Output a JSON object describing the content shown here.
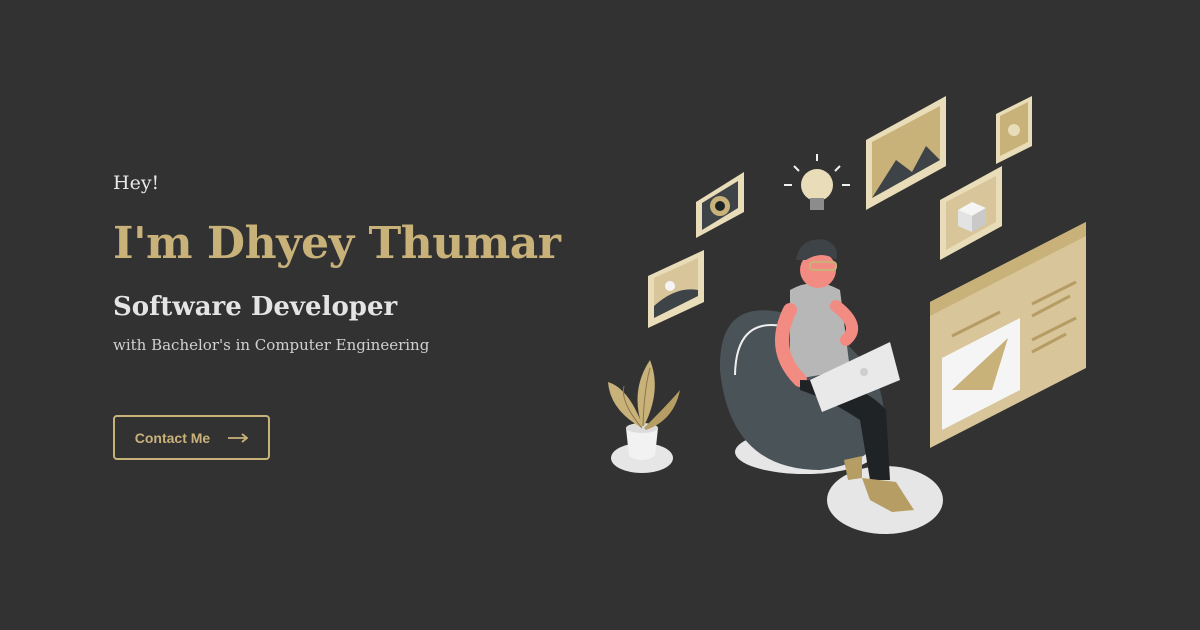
{
  "hero": {
    "greeting": "Hey!",
    "name": "I'm Dhyey Thumar",
    "role": "Software Developer",
    "tagline": "with Bachelor's in Computer Engineering"
  },
  "cta": {
    "label": "Contact Me",
    "icon": "arrow-right-icon"
  },
  "colors": {
    "background": "#323232",
    "accent": "#c8b27a",
    "text": "#e4e4e4"
  },
  "illustration": {
    "subject": "developer-with-laptop-illustration"
  }
}
